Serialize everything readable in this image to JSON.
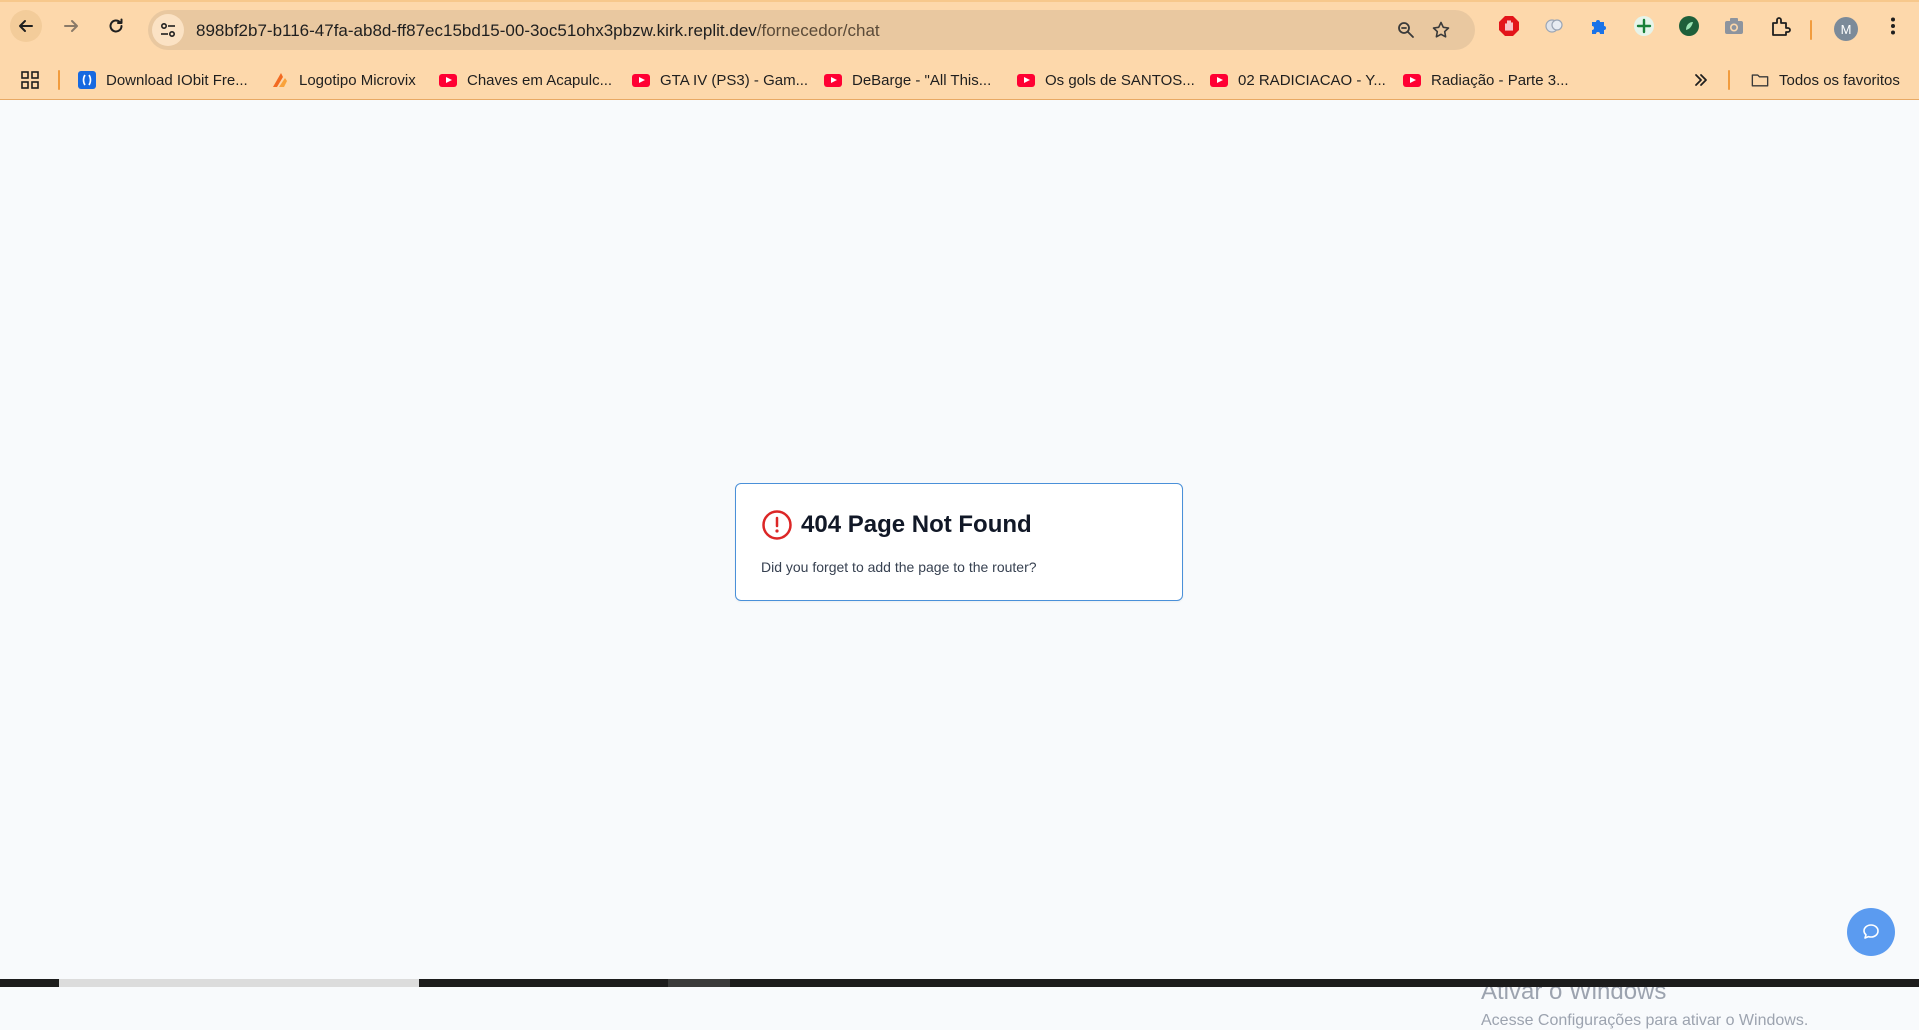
{
  "browser": {
    "url_host": "898bf2b7-b116-47fa-ab8d-ff87ec15bd15-00-3oc51ohx3pbzw.kirk.replit.dev",
    "url_path": "/fornecedor/chat",
    "profile_initial": "M"
  },
  "bookmarks": {
    "items": [
      {
        "label": "Download IObit Fre...",
        "icon": "iobit-icon"
      },
      {
        "label": "Logotipo Microvix",
        "icon": "microvix-icon"
      },
      {
        "label": "Chaves em Acapulc...",
        "icon": "youtube-icon"
      },
      {
        "label": "GTA IV (PS3) - Gam...",
        "icon": "youtube-icon"
      },
      {
        "label": "DeBarge - \"All This...",
        "icon": "youtube-icon"
      },
      {
        "label": "Os gols de SANTOS...",
        "icon": "youtube-icon"
      },
      {
        "label": "02 RADICIACAO - Y...",
        "icon": "youtube-icon"
      },
      {
        "label": "Radiação - Parte 3...",
        "icon": "youtube-icon"
      }
    ],
    "all_bookmarks_label": "Todos os favoritos"
  },
  "page": {
    "error_title": "404 Page Not Found",
    "error_message": "Did you forget to add the page to the router?"
  },
  "watermark": {
    "line1": "Ativar o Windows",
    "line2": "Acesse Configurações para ativar o Windows."
  },
  "colors": {
    "chrome_bar": "#fdd8ab",
    "error_icon": "#dc2626",
    "card_border": "#4a90d9",
    "chat_button": "#5b9bf0"
  }
}
